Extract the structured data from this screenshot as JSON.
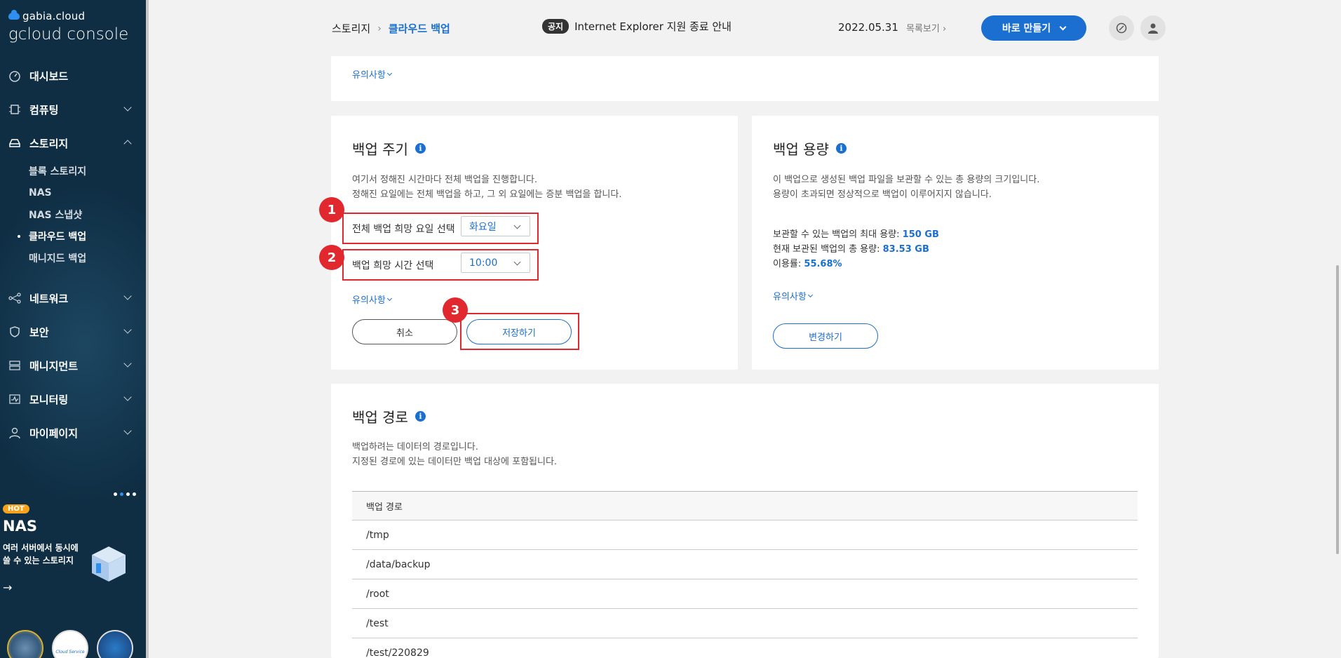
{
  "sidebar": {
    "logo_small": "gabia.cloud",
    "logo_main": "gcloud console",
    "items": [
      {
        "label": "대시보드",
        "icon": "dashboard-icon"
      },
      {
        "label": "컴퓨팅",
        "icon": "chip-icon"
      },
      {
        "label": "스토리지",
        "icon": "storage-icon"
      },
      {
        "label": "네트워크",
        "icon": "network-icon"
      },
      {
        "label": "보안",
        "icon": "shield-icon"
      },
      {
        "label": "매니지먼트",
        "icon": "server-icon"
      },
      {
        "label": "모니터링",
        "icon": "monitor-icon"
      },
      {
        "label": "마이페이지",
        "icon": "user-icon"
      }
    ],
    "storage_sub": [
      "블록 스토리지",
      "NAS",
      "NAS 스냅샷",
      "클라우드 백업",
      "매니지드 백업"
    ],
    "promo": {
      "tag": "HOT",
      "title": "NAS",
      "desc": "여러 서버에서 동시에 쓸 수 있는 스토리지",
      "arrow": "→"
    },
    "badge_text": "Cloud Service"
  },
  "header": {
    "breadcrumb_parent": "스토리지",
    "breadcrumb_sep": "›",
    "breadcrumb_current": "클라우드 백업",
    "notice_tag": "공지",
    "notice_text": "Internet Explorer 지원 종료 안내",
    "notice_date": "2022.05.31",
    "notice_more": "목록보기 ›",
    "make_button": "바로 만들기",
    "colors": {
      "accent": "#1a6fd0",
      "sidebar": "#0f2e44",
      "annotation": "#e0282e"
    }
  },
  "top_card": {
    "more": "유의사항"
  },
  "cycle": {
    "title": "백업 주기",
    "desc1": "여기서 정해진 시간마다 전체 백업을 진행합니다.",
    "desc2": "정해진 요일에는 전체 백업을 하고, 그 외 요일에는 증분 백업을 합니다.",
    "day_label": "전체 백업 희망 요일 선택",
    "day_value": "화요일",
    "time_label": "백업 희망 시간 선택",
    "time_value": "10:00",
    "more": "유의사항",
    "cancel": "취소",
    "save": "저장하기",
    "markers": [
      "1",
      "2",
      "3"
    ]
  },
  "capacity": {
    "title": "백업 용량",
    "desc1": "이 백업으로 생성된 백업 파일을 보관할 수 있는 총 용량의 크기입니다.",
    "desc2": "용량이 초과되면 정상적으로 백업이 이루어지지 않습니다.",
    "max_label": "보관할 수 있는 백업의 최대 용량:",
    "max_value": "150 GB",
    "used_label": "현재 보관된 백업의 총 용량:",
    "used_value": "83.53 GB",
    "rate_label": "이용률:",
    "rate_value": "55.68%",
    "more": "유의사항",
    "change": "변경하기"
  },
  "paths": {
    "title": "백업 경로",
    "desc1": "백업하려는 데이터의 경로입니다.",
    "desc2": "지정된 경로에 있는 데이터만 백업 대상에 포함됩니다.",
    "header": "백업 경로",
    "rows": [
      "/tmp",
      "/data/backup",
      "/root",
      "/test",
      "/test/220829"
    ]
  }
}
